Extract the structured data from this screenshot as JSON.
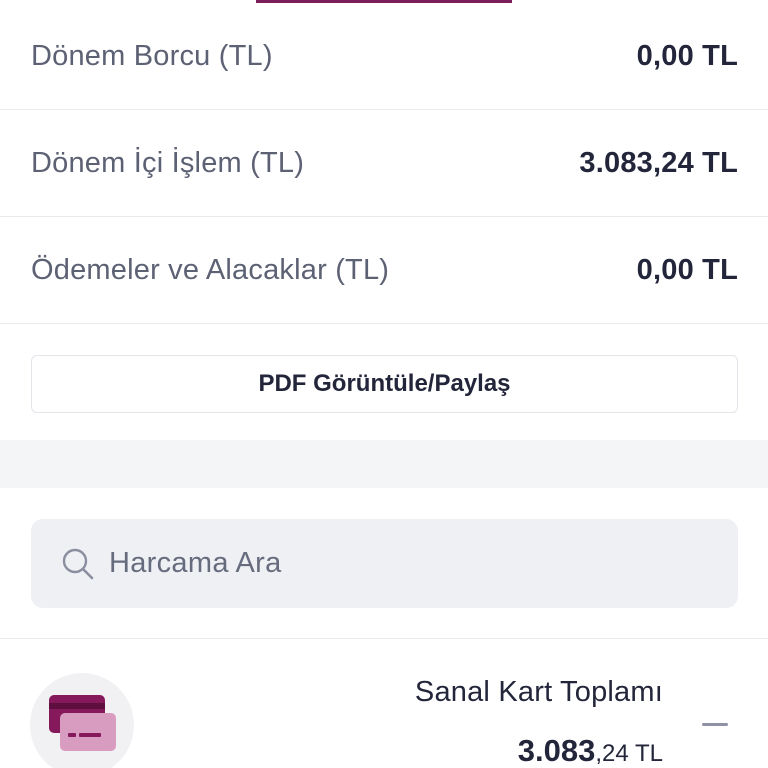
{
  "summary": {
    "rows": [
      {
        "label": "Dönem Borcu (TL)",
        "value": "0,00 TL"
      },
      {
        "label": "Dönem İçi İşlem (TL)",
        "value": "3.083,24 TL"
      },
      {
        "label": "Ödemeler ve Alacaklar (TL)",
        "value": "0,00 TL"
      }
    ],
    "pdf_button_label": "PDF Görüntüle/Paylaş"
  },
  "search": {
    "placeholder": "Harcama Ara"
  },
  "card_total": {
    "title": "Sanal Kart Toplamı",
    "amount_integer": "3.083",
    "amount_decimal": ",24",
    "currency": " TL",
    "icon": "credit-cards-icon"
  },
  "colors": {
    "accent": "#7b1e5a",
    "icon_dark": "#86195b",
    "icon_light": "#d79cc0",
    "search_bg": "#eef0f4",
    "text_primary": "#23263a",
    "text_secondary": "#5d6174"
  }
}
